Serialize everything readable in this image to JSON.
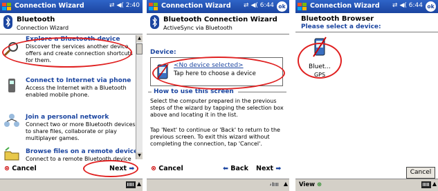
{
  "colors": {
    "title_bar": "#1b45a0",
    "accent_text": "#1b45a0",
    "highlight_oval": "#e02020"
  },
  "screen1": {
    "title": "Connection Wizard",
    "status": "2:40",
    "header_title": "Bluetooth",
    "header_subtitle": "Connection Wizard",
    "items": [
      {
        "heading": "Explore a Bluetooth device",
        "desc": "Discover the services another device offers and create connection shortcuts for them.",
        "icon": "bluetooth-device-icon"
      },
      {
        "heading": "Connect to Internet via phone",
        "desc": "Access the Internet with a Bluetooth enabled mobile phone.",
        "icon": "phone-icon"
      },
      {
        "heading": "Join a personal network",
        "desc": "Connect two or more Bluetooth devices to share files, collaborate or play multiplayer games.",
        "icon": "network-icon"
      },
      {
        "heading": "Browse files on a remote device",
        "desc": "Connect to a remote Bluetooth device",
        "icon": "folder-icon"
      }
    ],
    "cancel_label": "Cancel",
    "next_label": "Next"
  },
  "screen2": {
    "title": "Connection Wizard",
    "status": "6:44",
    "ok_label": "ok",
    "header_title": "Bluetooth Connection Wizard",
    "header_subtitle": "ActiveSync via Bluetooth",
    "device_label": "Device:",
    "no_device": "<No device selected>",
    "tap_text": "Tap here to choose a device",
    "howto_label": "How to use this screen",
    "para1": "Select the computer prepared in the previous steps of the wizard by tapping the selection box above and locating it in the list.",
    "para2": "Tap 'Next' to continue or 'Back' to return to the previous screen. To exit this wizard without completing the connection, tap 'Cancel'.",
    "cancel_label": "Cancel",
    "back_label": "Back",
    "next_label": "Next"
  },
  "screen3": {
    "title": "Connection Wizard",
    "status": "6:44",
    "ok_label": "ok",
    "header_title": "Bluetooth Browser",
    "header_subtitle": "Please select a device:",
    "device_name_line1": "Bluet...",
    "device_name_line2": "GPS",
    "cancel_label": "Cancel",
    "view_label": "View"
  }
}
